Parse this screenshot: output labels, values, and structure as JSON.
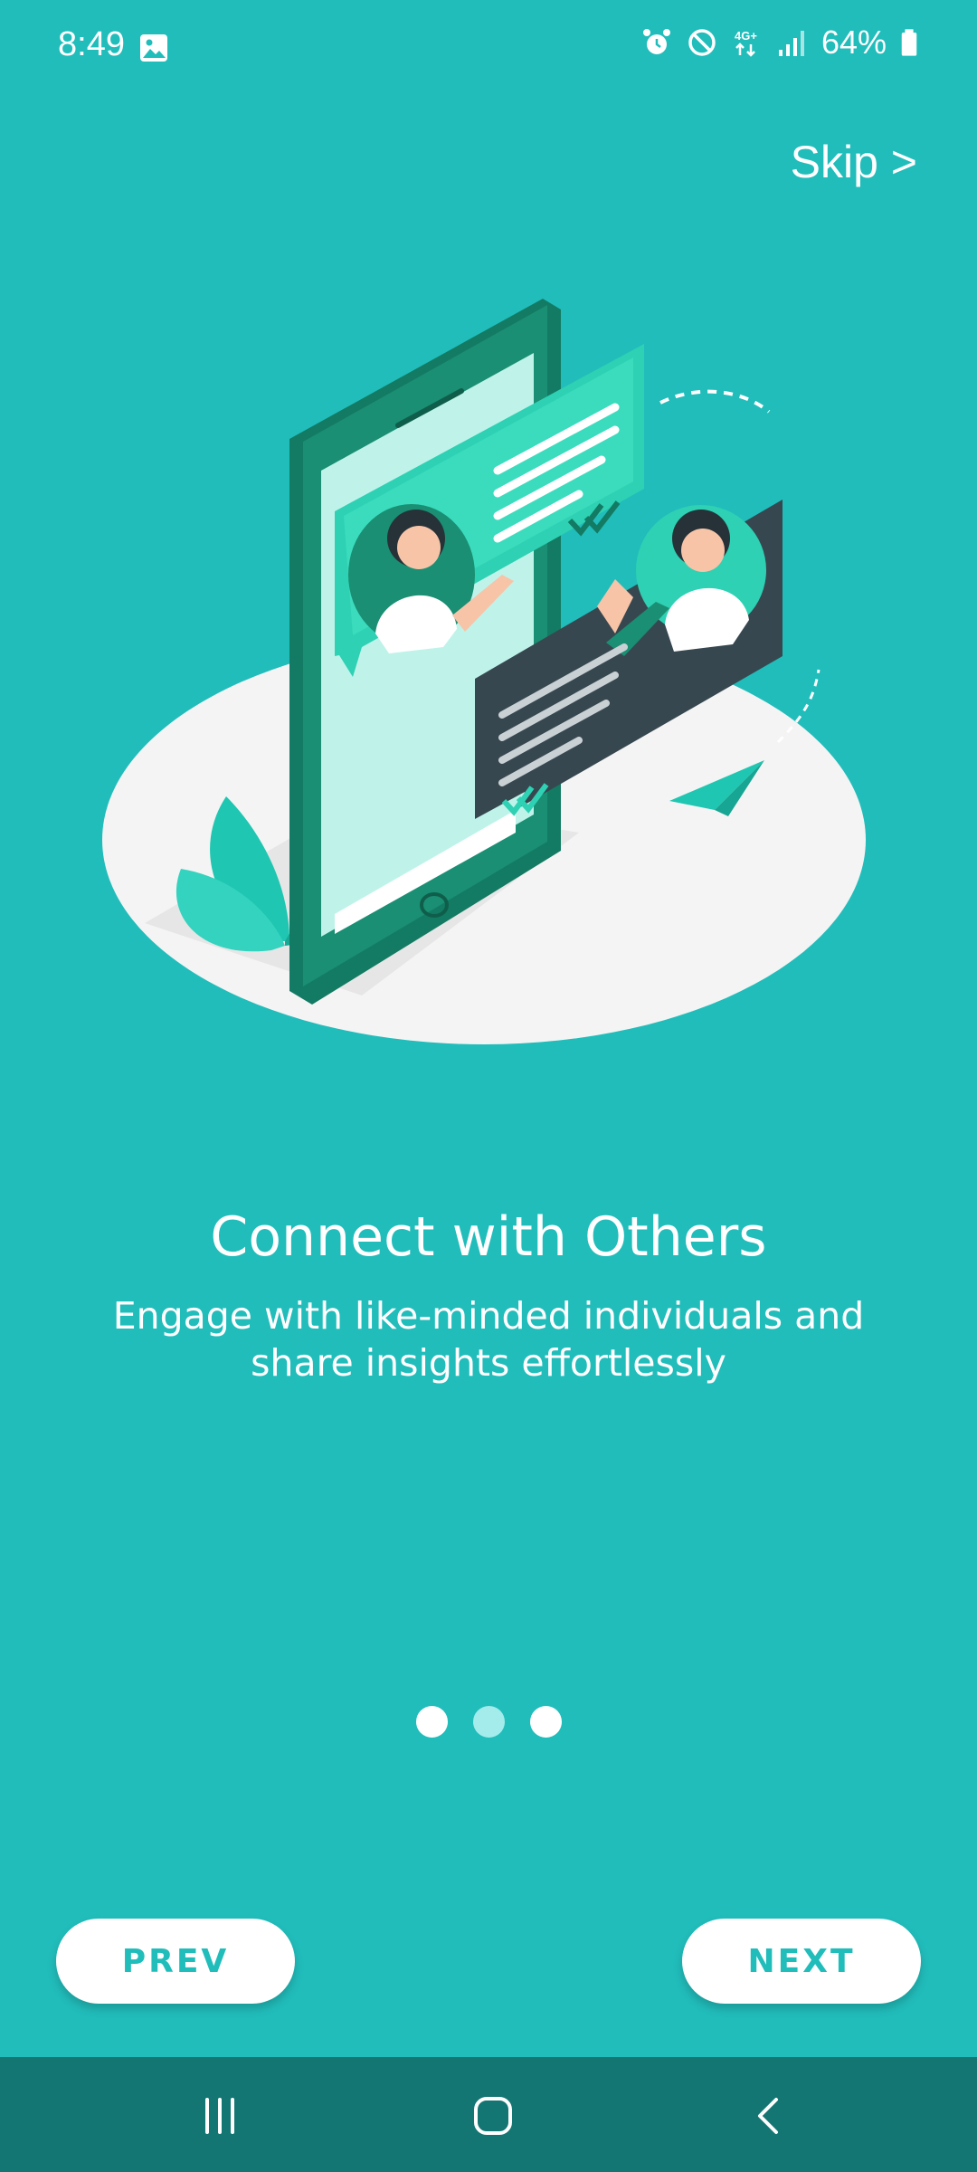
{
  "status_bar": {
    "time": "8:49",
    "battery": "64%",
    "icons": [
      "gallery-icon",
      "alarm-icon",
      "do-not-disturb-icon",
      "4g-lte-icon",
      "signal-icon",
      "battery-icon"
    ]
  },
  "header": {
    "skip_label": "Skip >"
  },
  "onboarding": {
    "title": "Connect with Others",
    "description": "Engage with like-minded individuals and share insights effortlessly",
    "page_count": 3,
    "active_page": 2
  },
  "footer": {
    "prev_label": "PREV",
    "next_label": "NEXT"
  },
  "nav_bar": {
    "icons": [
      "recents-icon",
      "home-icon",
      "back-icon"
    ]
  },
  "colors": {
    "background": "#21bdbb",
    "accent": "#21bdbb",
    "dot_active": "#a3eceb",
    "nav_bar": "#137673"
  }
}
